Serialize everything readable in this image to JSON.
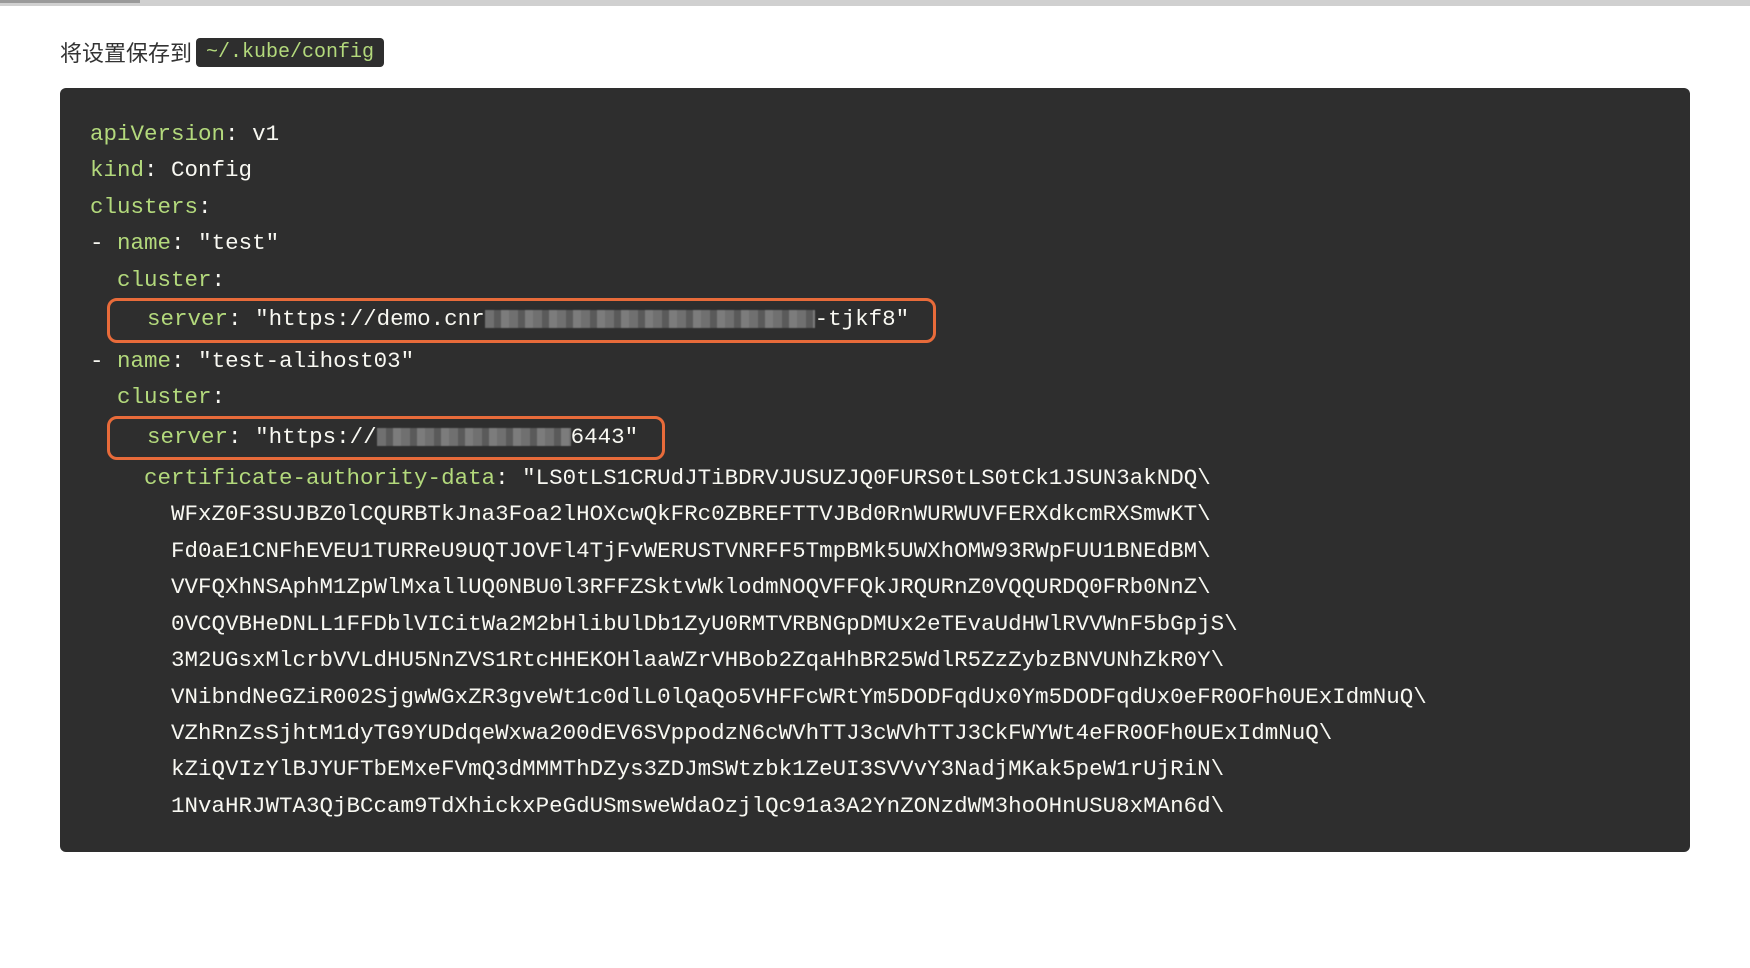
{
  "intro": {
    "prefix": "将设置保存到",
    "path": "~/.kube/config"
  },
  "yaml": {
    "apiVersion_key": "apiVersion",
    "apiVersion_val": "v1",
    "kind_key": "kind",
    "kind_val": "Config",
    "clusters_key": "clusters",
    "name_key": "name",
    "cluster_key": "cluster",
    "server_key": "server",
    "cad_key": "certificate-authority-data",
    "cluster1_name": "\"test\"",
    "cluster1_server_pre": "\"https://demo.cnr",
    "cluster1_server_post": "-tjkf8\"",
    "cluster2_name": "\"test-alihost03\"",
    "cluster2_server_pre": "\"https://",
    "cluster2_server_post": "6443\"",
    "cad_line0": "\"LS0tLS1CRUdJTiBDRVJUSUZJQ0FURS0tLS0tCk1JSUN3akNDQ\\",
    "cad_lines": [
      "WFxZ0F3SUJBZ0lCQURBTkJna3Foa2lHOXcwQkFRc0ZBREFTTVJBd0RnWURWUVFERXdkcmRXSmwKT\\",
      "Fd0aE1CNFhEVEU1TURReU9UQTJOVFl4TjFvWERUSTVNRFF5TmpBMk5UWXhOMW93RWpFUU1BNEdBM\\",
      "VVFQXhNSAphM1ZpWlMxallUQ0NBU0l3RFFZSktvWklodmNOQVFFQkJRQURnZ0VQQURDQ0FRb0NnZ\\",
      "0VCQVBHeDNLL1FFDblVICitWa2M2bHlibUlDb1ZyU0RMTVRBNGpDMUx2eTEvaUdHWlRVVWnF5bGpjS\\",
      "3M2UGsxMlcrbVVLdHU5NnZVS1RtcHHEKOHlaaWZrVHBob2ZqaHhBR25WdlR5ZzZybzBNVUNhZkR0Y\\",
      "VNibndNeGZiR002SjgwWGxZR3gveWt1c0dlL0lQaQo5VHFFcWRtYm5DODFqdUx0Ym5DODFqdUx0eFR0OFh0UExIdmNuQ\\",
      "VZhRnZsSjhtM1dyTG9YUDdqeWxwa200dEV6SVppodzN6cWVhTTJ3cWVhTTJ3CkFWYWt4eFR0OFh0UExIdmNuQ\\",
      "kZiQVIzYlBJYUFTbEMxeFVmQ3dMMMThDZys3ZDJmSWtzbk1ZeUI3SVVvY3NadjMKak5peW1rUjRiN\\",
      "1NvaHRJWTA3QjBCcam9TdXhickxPeGdUSmsweWdaOzjlQc91a3A2YnZONzdWM3hoOHnUSU8xMAn6d\\"
    ]
  }
}
